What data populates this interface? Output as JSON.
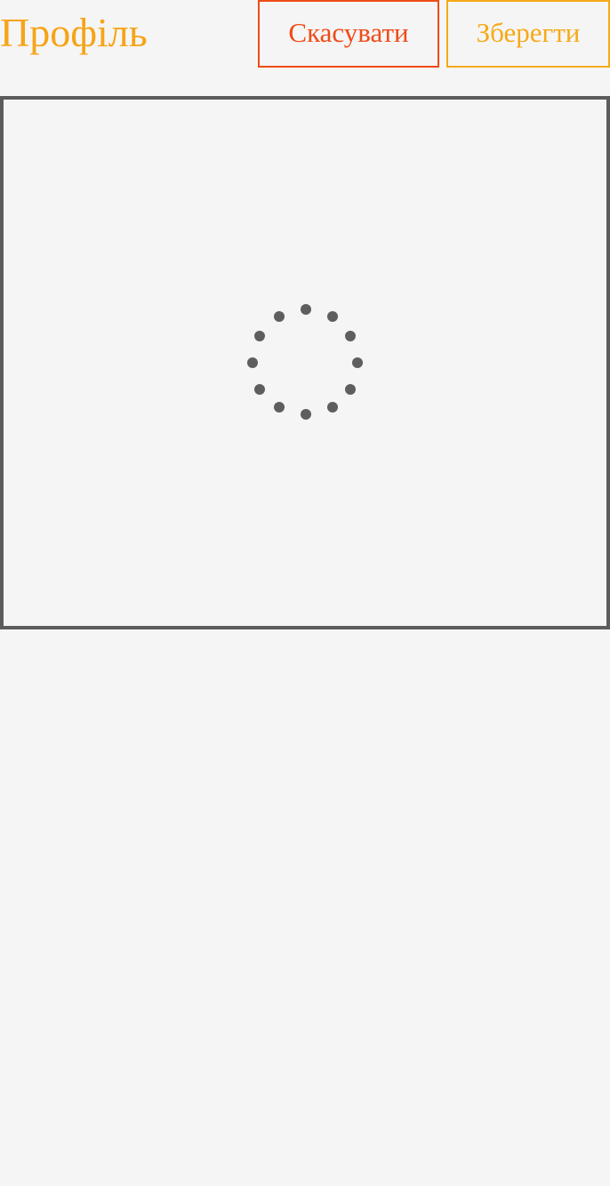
{
  "header": {
    "title": "Профіль",
    "cancel_label": "Скасувати",
    "save_label": "Зберегти"
  },
  "content": {
    "state": "loading",
    "spinner_icon": "loading-spinner-icon"
  },
  "colors": {
    "title": "#f6a417",
    "cancel": "#f04a17",
    "save": "#f6a917",
    "frame_border": "#5c5c5c",
    "spinner": "#5e5e5e",
    "background": "#f5f5f5"
  }
}
